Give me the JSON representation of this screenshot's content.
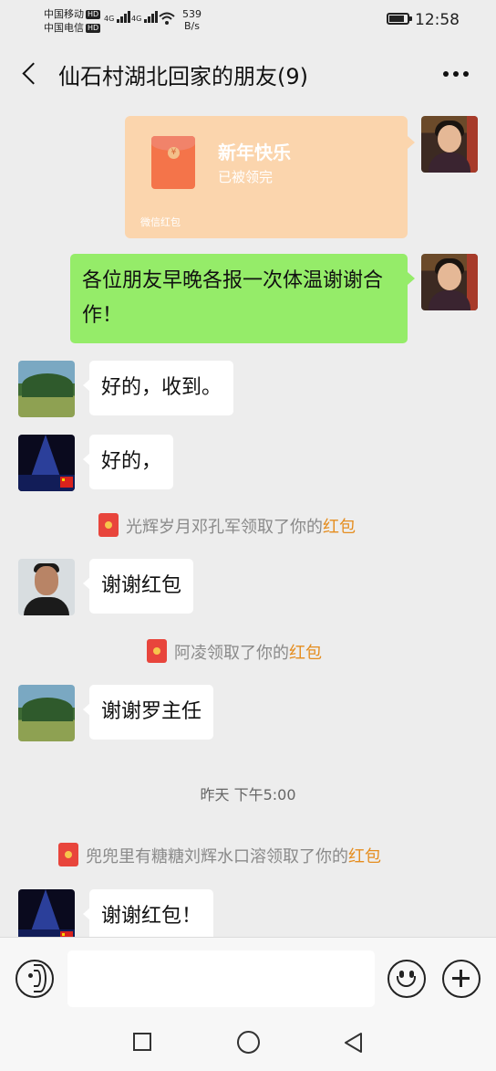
{
  "status_bar": {
    "carrier_1": "中国移动",
    "carrier_2": "中国电信",
    "hd_badge": "HD",
    "network_1": "4G",
    "network_2": "4G",
    "speed_value": "539",
    "speed_unit": "B/s",
    "time": "12:58"
  },
  "header": {
    "title": "仙石村湖北回家的朋友(9)"
  },
  "messages": {
    "red_packet": {
      "title": "新年快乐",
      "status": "已被领完",
      "footer": "微信红包",
      "seal": "¥"
    },
    "m1": "各位朋友早晚各报一次体温谢谢合作！",
    "m2": "好的，收到。",
    "m3": "好的，",
    "n1_text": "光辉岁月邓孔军领取了你的",
    "n1_link": "红包",
    "m4": "谢谢红包",
    "n2_text": "阿凌领取了你的",
    "n2_link": "红包",
    "m5": "谢谢罗主任",
    "timestamp": "昨天 下午5:00",
    "n3_text": "兜兜里有糖糖刘辉水口溶领取了你的",
    "n3_link": "红包",
    "m6": "谢谢红包！"
  },
  "colors": {
    "accent_green": "#95ec69",
    "red_packet_received": "#fbd5ad",
    "highlight_orange": "#e58d1f"
  },
  "icons": [
    "back-icon",
    "more-icon",
    "voice-icon",
    "emoji-icon",
    "plus-icon",
    "nav-square-icon",
    "nav-home-icon",
    "nav-back-icon"
  ]
}
